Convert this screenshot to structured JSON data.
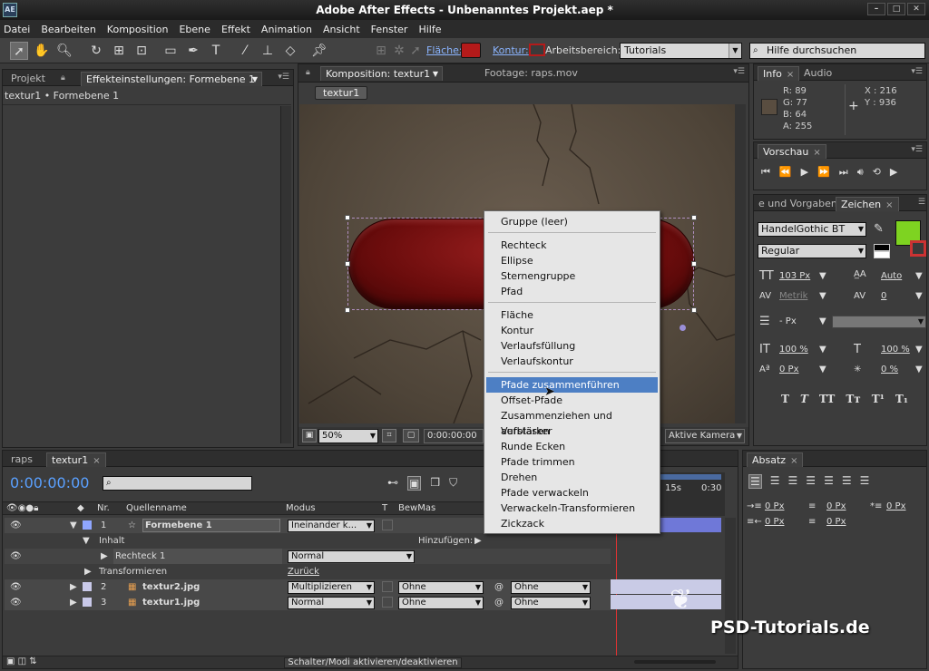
{
  "app": {
    "title": "Adobe After Effects - Unbenanntes Projekt.aep *",
    "logo": "AE"
  },
  "menu": [
    "Datei",
    "Bearbeiten",
    "Komposition",
    "Ebene",
    "Effekt",
    "Animation",
    "Ansicht",
    "Fenster",
    "Hilfe"
  ],
  "toolbar": {
    "fill_label": "Fläche:",
    "stroke_label": "Kontur:",
    "workspace_label": "Arbeitsbereich:",
    "workspace_value": "Tutorials",
    "help_placeholder": "Hilfe durchsuchen",
    "fill_color": "#b41a1a"
  },
  "left_panel": {
    "tab_project": "Projekt",
    "tab_effects": "Effekteinstellungen: Formebene 1",
    "breadcrumb": "textur1 • Formebene 1"
  },
  "comp_panel": {
    "tab_comp": "Komposition: textur1",
    "tab_footage": "Footage: raps.mov",
    "comp_button": "textur1",
    "zoom": "50%",
    "timecode": "0:00:00:00",
    "camera": "Aktive Kamera"
  },
  "context_menu": {
    "items": [
      "Gruppe (leer)",
      "Rechteck",
      "Ellipse",
      "Sternengruppe",
      "Pfad",
      "Fläche",
      "Kontur",
      "Verlaufsfüllung",
      "Verlaufskontur",
      "Pfade zusammenführen",
      "Offset-Pfade",
      "Zusammenziehen und aufblasen",
      "Verstärker",
      "Runde Ecken",
      "Pfade trimmen",
      "Drehen",
      "Pfade verwackeln",
      "Verwackeln-Transformieren",
      "Zickzack"
    ],
    "highlighted": "Pfade zusammenführen"
  },
  "info": {
    "tab_info": "Info",
    "tab_audio": "Audio",
    "r": "R:  89",
    "g": "G:  77",
    "b": "B:  64",
    "a": "A:  255",
    "x": "X : 216",
    "y": "Y : 936",
    "swatch": "#594d40"
  },
  "preview": {
    "tab": "Vorschau"
  },
  "character": {
    "tab_presets": "e und Vorgaben",
    "tab_char": "Zeichen",
    "font": "HandelGothic BT",
    "style": "Regular",
    "size": "103 Px",
    "leading": "Auto",
    "kerning": "Metrik",
    "tracking": "0",
    "stroke_width": "- Px",
    "vscale": "100 %",
    "hscale": "100 %",
    "baseline": "0 Px",
    "tsume": "0 %",
    "fill_color": "#7ed321",
    "style_buttons": [
      "T",
      "T",
      "TT",
      "Tт",
      "T¹",
      "T₁"
    ]
  },
  "paragraph": {
    "tab": "Absatz",
    "indent_left": "0 Px",
    "indent_right": "0 Px",
    "space_before": "0 Px",
    "first_line": "0 Px",
    "space_after": "0 Px"
  },
  "timeline": {
    "tab_raps": "raps",
    "tab_textur1": "textur1",
    "timecode": "0:00:00:00",
    "search_placeholder": "",
    "col_nr": "Nr.",
    "col_source": "Quellenname",
    "col_mode": "Modus",
    "col_t": "T",
    "col_trkmat": "BewMas",
    "time_15": "15s",
    "time_30": "0:30",
    "rows": [
      {
        "nr": "1",
        "name": "Formebene 1",
        "mode": "Ineinander k...",
        "type": "shape"
      },
      {
        "label": "Inhalt",
        "extra": "Hinzufügen:"
      },
      {
        "label": "Rechteck 1",
        "mode": "Normal"
      },
      {
        "label": "Transformieren",
        "link": "Zurück"
      },
      {
        "nr": "2",
        "name": "textur2.jpg",
        "mode": "Multiplizieren",
        "trkmat": "Ohne",
        "parent": "Ohne"
      },
      {
        "nr": "3",
        "name": "textur1.jpg",
        "mode": "Normal",
        "trkmat": "Ohne",
        "parent": "Ohne"
      }
    ],
    "bottom_button": "Schalter/Modi aktivieren/deaktivieren"
  },
  "watermark": "PSD-Tutorials.de"
}
